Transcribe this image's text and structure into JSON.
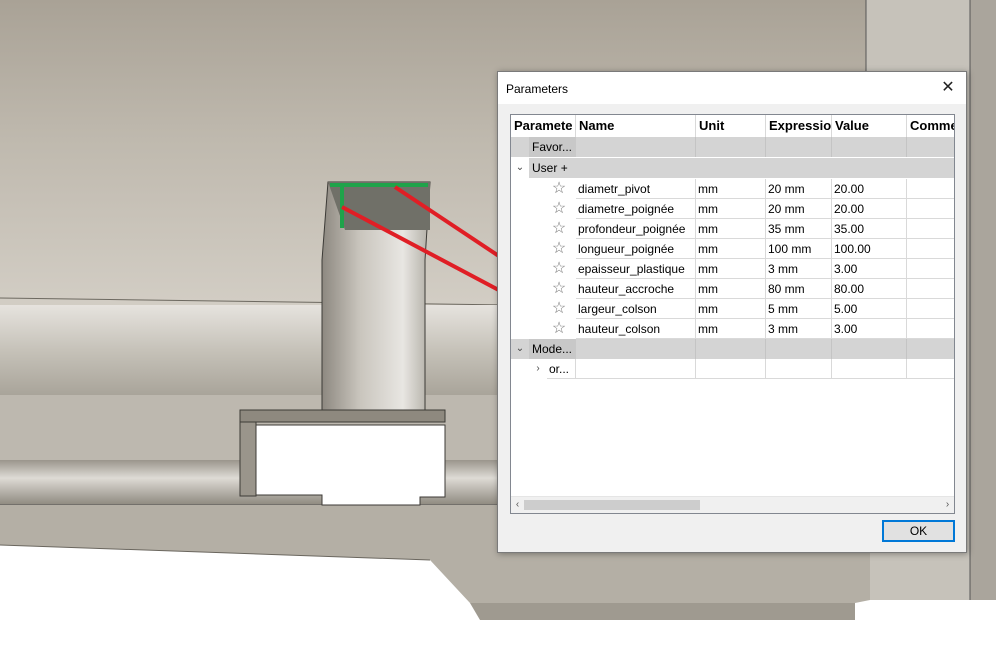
{
  "dialog": {
    "title": "Parameters",
    "ok_label": "OK"
  },
  "columns": [
    "Paramete",
    "Name",
    "Unit",
    "Expressio",
    "Value",
    "Comme"
  ],
  "groups": {
    "favorites": "Favor...",
    "user": "User",
    "user_add": "+",
    "model": "Mode...",
    "model_child": "or..."
  },
  "user_parameters": [
    {
      "name": "diametr_pivot",
      "unit": "mm",
      "expression": "20 mm",
      "value": "20.00"
    },
    {
      "name": "diametre_poignée",
      "unit": "mm",
      "expression": "20 mm",
      "value": "20.00"
    },
    {
      "name": "profondeur_poignée",
      "unit": "mm",
      "expression": "35 mm",
      "value": "35.00"
    },
    {
      "name": "longueur_poignée",
      "unit": "mm",
      "expression": "100 mm",
      "value": "100.00"
    },
    {
      "name": "epaisseur_plastique",
      "unit": "mm",
      "expression": "3 mm",
      "value": "3.00"
    },
    {
      "name": "hauteur_accroche",
      "unit": "mm",
      "expression": "80 mm",
      "value": "80.00"
    },
    {
      "name": "largeur_colson",
      "unit": "mm",
      "expression": "5 mm",
      "value": "5.00"
    },
    {
      "name": "hauteur_colson",
      "unit": "mm",
      "expression": "3 mm",
      "value": "3.00"
    }
  ],
  "icons": {
    "close": "close-icon",
    "favorite": "star-outline-icon",
    "expand": "chevron-down-icon",
    "collapse": "chevron-right-icon"
  },
  "colors": {
    "annotation_line": "#e01e25",
    "highlight_edge": "#1fa34a",
    "ok_border": "#0078d7",
    "group_row": "#d4d4d4"
  }
}
